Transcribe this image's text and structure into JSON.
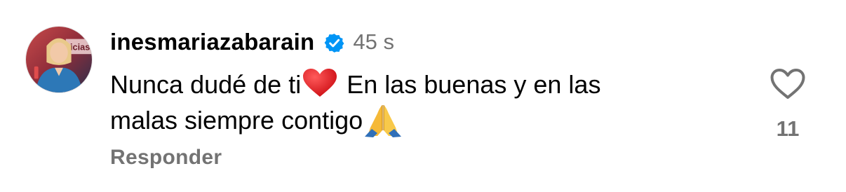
{
  "comment": {
    "username": "inesmariazabarain",
    "verified": true,
    "timestamp": "45 s",
    "text_line1_a": "Nunca dudé de ti",
    "text_line1_b": " En las buenas y en las",
    "text_line2": "malas siempre contigo",
    "emojis": [
      "red-heart",
      "folded-hands"
    ],
    "reply_label": "Responder",
    "like_count": "11",
    "avatar_text": "ticias"
  },
  "colors": {
    "verified_badge": "#0095F6",
    "secondary_text": "#737373",
    "heart_emoji": "#E0171A",
    "like_icon": "#737373"
  },
  "icons": [
    "verified-badge-icon",
    "heart-outline-icon"
  ]
}
